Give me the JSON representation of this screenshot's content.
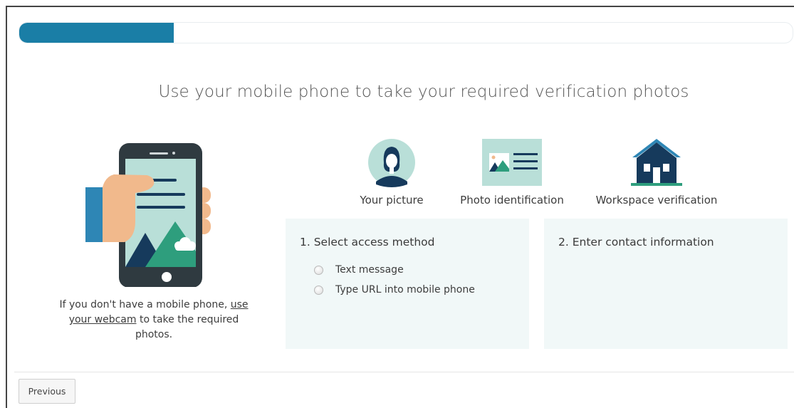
{
  "progress": {
    "fraction": 0.2
  },
  "title": "Use your mobile phone to take your required verification photos",
  "webcam_note": {
    "before": "If you don't have a mobile phone, ",
    "link": "use your webcam",
    "after": " to take the required photos."
  },
  "steps": [
    {
      "label": "Your picture",
      "icon": "person-avatar-icon"
    },
    {
      "label": "Photo identification",
      "icon": "id-card-icon"
    },
    {
      "label": "Workspace verification",
      "icon": "house-icon"
    }
  ],
  "access_card": {
    "title": "1. Select access method",
    "options": [
      "Text message",
      "Type URL into mobile phone"
    ]
  },
  "contact_card": {
    "title": "2. Enter contact information"
  },
  "footer": {
    "previous_label": "Previous"
  },
  "colors": {
    "progress": "#1a7ea6",
    "teal": "#2e9e7d",
    "navy": "#163a5c",
    "card_bg": "#f1f8f8",
    "phone_screen": "#b9dfd8",
    "hand": "#f1b98c",
    "sleeve": "#2e86b5"
  }
}
